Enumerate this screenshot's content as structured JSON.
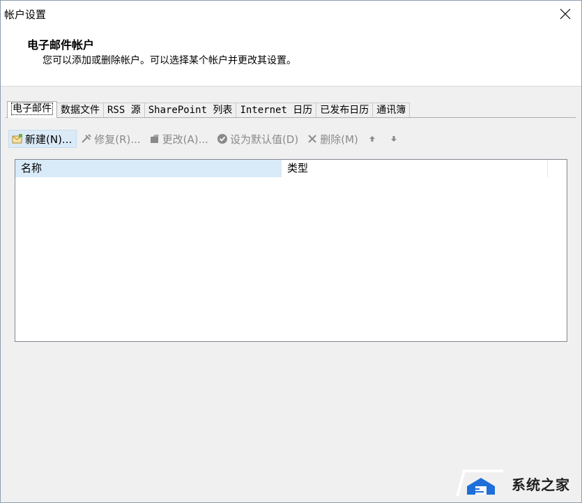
{
  "window": {
    "title": "帐户设置"
  },
  "header": {
    "title": "电子邮件帐户",
    "subtitle": "您可以添加或删除帐户。可以选择某个帐户并更改其设置。"
  },
  "tabs": [
    {
      "label": "电子邮件",
      "active": true
    },
    {
      "label": "数据文件"
    },
    {
      "label": "RSS 源"
    },
    {
      "label": "SharePoint 列表"
    },
    {
      "label": "Internet 日历"
    },
    {
      "label": "已发布日历"
    },
    {
      "label": "通讯簿"
    }
  ],
  "toolbar": {
    "new_label": "新建(N)...",
    "repair_label": "修复(R)...",
    "change_label": "更改(A)...",
    "default_label": "设为默认值(D)",
    "delete_label": "删除(M)"
  },
  "list": {
    "columns": [
      "名称",
      "类型"
    ]
  },
  "watermark": {
    "text": "系统之家"
  },
  "colors": {
    "accent": "#dbeaf7",
    "border": "#828790"
  }
}
